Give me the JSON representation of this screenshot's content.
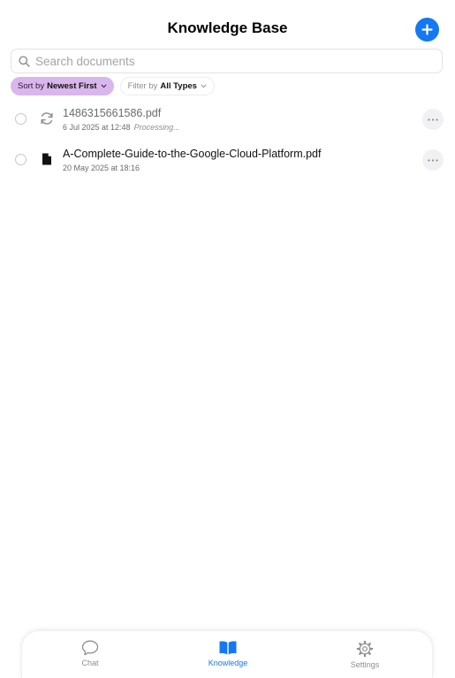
{
  "header": {
    "title": "Knowledge Base",
    "add_icon": "plus-icon",
    "accent": "#1478f5"
  },
  "search": {
    "placeholder": "Search documents",
    "value": "",
    "icon": "magnifier-icon"
  },
  "sort": {
    "prefix": "Sort by",
    "value": "Newest First",
    "color": "#d9b6ec"
  },
  "filter": {
    "prefix": "Filter by",
    "value": "All Types"
  },
  "documents": [
    {
      "name": "1486315661586.pdf",
      "date": "6 Jul 2025 at 12:48",
      "status": "Processing...",
      "icon": "sync-icon"
    },
    {
      "name": "A-Complete-Guide-to-the-Google-Cloud-Platform.pdf",
      "date": "20 May 2025 at 18:16",
      "status": "",
      "icon": "document-icon"
    }
  ],
  "tabs": [
    {
      "label": "Chat",
      "icon": "chat-bubble-icon",
      "active": false
    },
    {
      "label": "Knowledge",
      "icon": "book-icon",
      "active": true
    },
    {
      "label": "Settings",
      "icon": "gear-icon",
      "active": false
    }
  ]
}
